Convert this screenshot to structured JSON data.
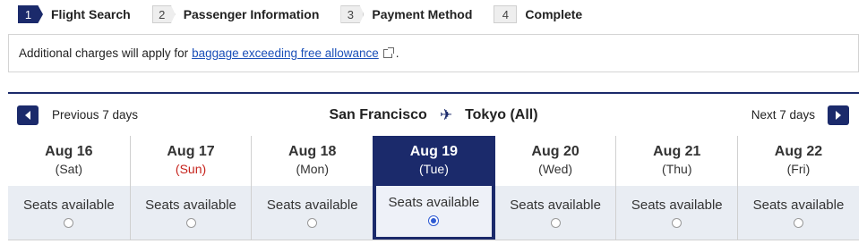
{
  "steps": [
    {
      "num": "1",
      "label": "Flight Search"
    },
    {
      "num": "2",
      "label": "Passenger Information"
    },
    {
      "num": "3",
      "label": "Payment Method"
    },
    {
      "num": "4",
      "label": "Complete"
    }
  ],
  "notice": {
    "text": "Additional charges will apply for",
    "link": "baggage exceeding free allowance",
    "suffix": "."
  },
  "calendar": {
    "prev_label": "Previous 7 days",
    "next_label": "Next 7 days",
    "origin": "San Francisco",
    "destination": "Tokyo (All)",
    "plane_icon": "✈",
    "days": [
      {
        "date": "Aug 16",
        "dow": "(Sat)",
        "seats": "Seats available"
      },
      {
        "date": "Aug 17",
        "dow": "(Sun)",
        "seats": "Seats available"
      },
      {
        "date": "Aug 18",
        "dow": "(Mon)",
        "seats": "Seats available"
      },
      {
        "date": "Aug 19",
        "dow": "(Tue)",
        "seats": "Seats available"
      },
      {
        "date": "Aug 20",
        "dow": "(Wed)",
        "seats": "Seats available"
      },
      {
        "date": "Aug 21",
        "dow": "(Thu)",
        "seats": "Seats available"
      },
      {
        "date": "Aug 22",
        "dow": "(Fri)",
        "seats": "Seats available"
      }
    ],
    "selected_index": 3
  },
  "colors": {
    "accent": "#1b2a6b",
    "sunday": "#c6231c",
    "link": "#1a4fb8",
    "radio_selected": "#2f5bd3"
  }
}
